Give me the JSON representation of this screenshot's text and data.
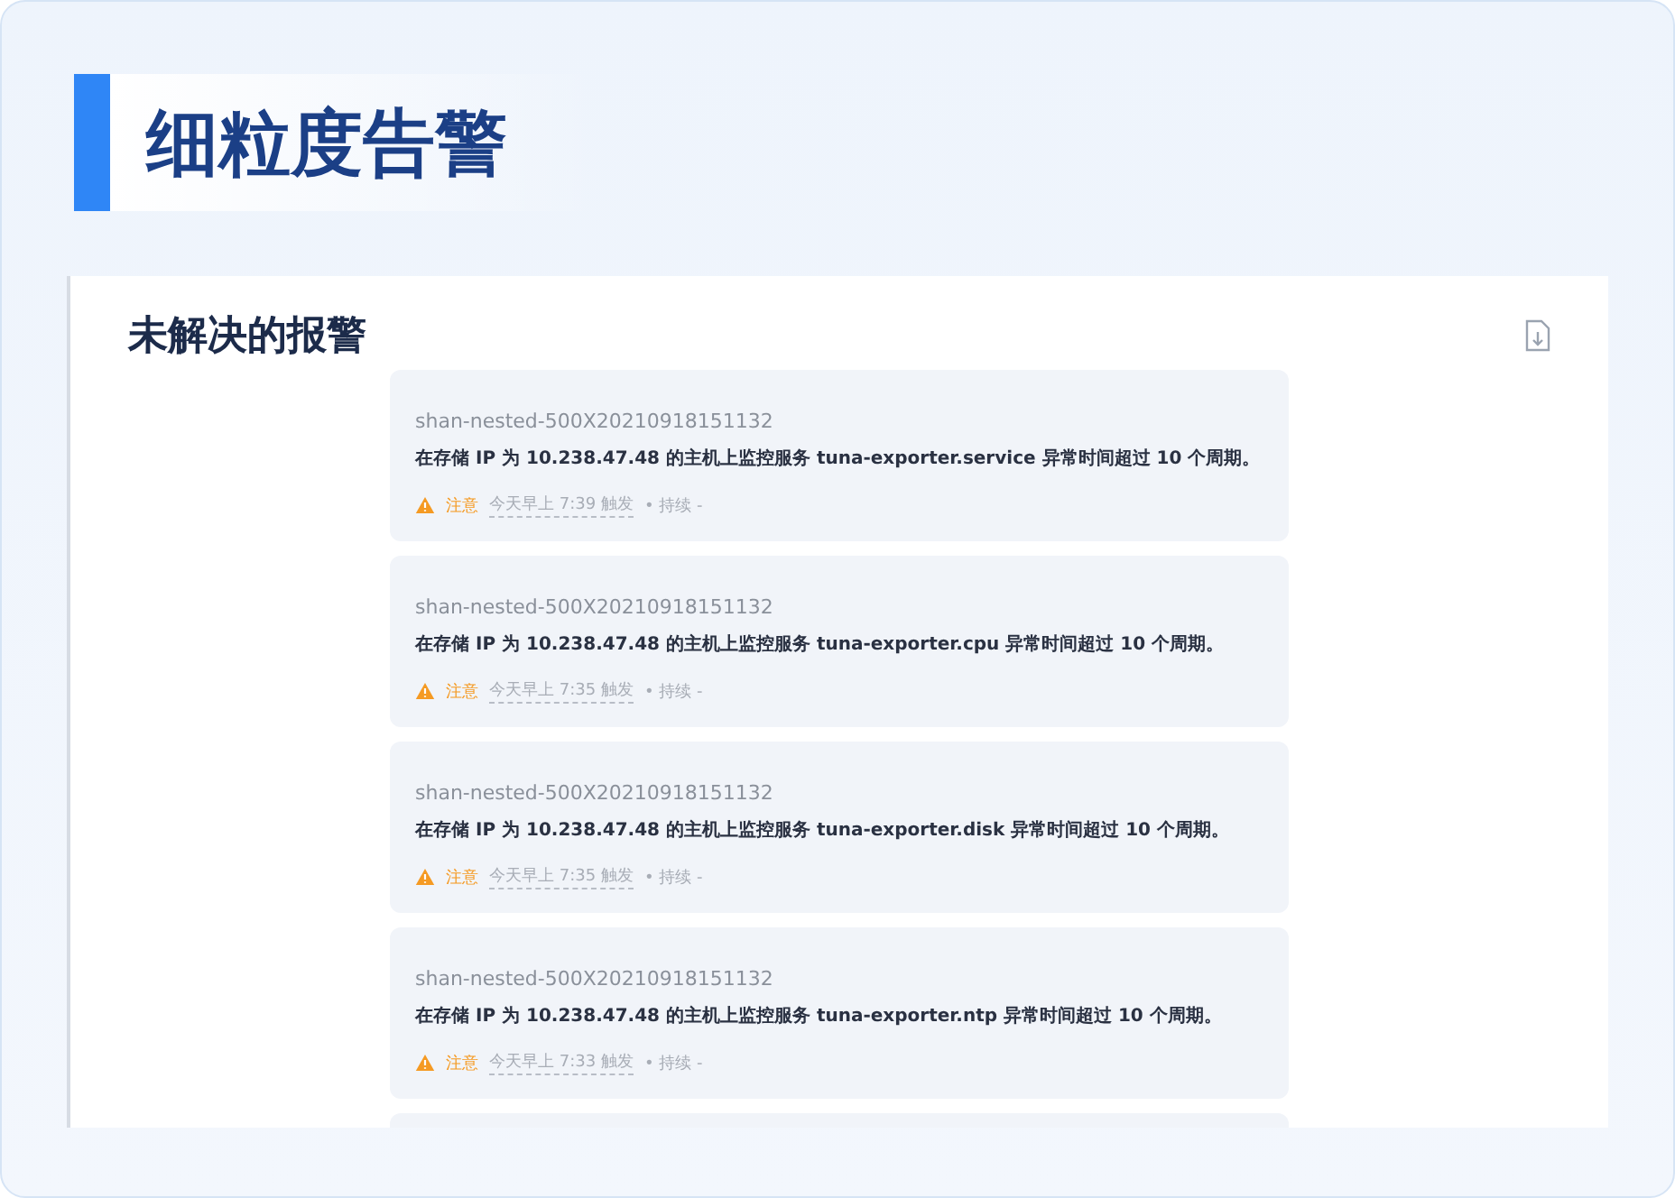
{
  "banner": {
    "title": "细粒度告警"
  },
  "panel": {
    "title": "未解决的报警",
    "alerts": [
      {
        "host": "shan-nested-500X20210918151132",
        "message": "在存储 IP 为 10.238.47.48 的主机上监控服务 tuna-exporter.service 异常时间超过 10 个周期。",
        "kind": "warning",
        "severity_label": "注意",
        "triggered": "今天早上 7:39 触发",
        "duration": "• 持续 -"
      },
      {
        "host": "shan-nested-500X20210918151132",
        "message": "在存储 IP 为 10.238.47.48 的主机上监控服务 tuna-exporter.cpu 异常时间超过 10 个周期。",
        "kind": "warning",
        "severity_label": "注意",
        "triggered": "今天早上 7:35 触发",
        "duration": "• 持续 -"
      },
      {
        "host": "shan-nested-500X20210918151132",
        "message": "在存储 IP 为 10.238.47.48 的主机上监控服务 tuna-exporter.disk 异常时间超过 10 个周期。",
        "kind": "warning",
        "severity_label": "注意",
        "triggered": "今天早上 7:35 触发",
        "duration": "• 持续 -"
      },
      {
        "host": "shan-nested-500X20210918151132",
        "message": "在存储 IP 为 10.238.47.48 的主机上监控服务 tuna-exporter.ntp 异常时间超过 10 个周期。",
        "kind": "warning",
        "severity_label": "注意",
        "triggered": "今天早上 7:33 触发",
        "duration": "• 持续 -"
      }
    ]
  }
}
